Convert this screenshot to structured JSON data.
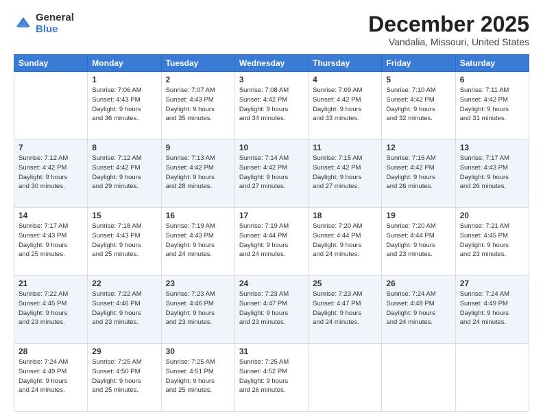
{
  "logo": {
    "general": "General",
    "blue": "Blue"
  },
  "header": {
    "month": "December 2025",
    "location": "Vandalia, Missouri, United States"
  },
  "weekdays": [
    "Sunday",
    "Monday",
    "Tuesday",
    "Wednesday",
    "Thursday",
    "Friday",
    "Saturday"
  ],
  "weeks": [
    [
      {
        "day": "",
        "info": ""
      },
      {
        "day": "1",
        "info": "Sunrise: 7:06 AM\nSunset: 4:43 PM\nDaylight: 9 hours\nand 36 minutes."
      },
      {
        "day": "2",
        "info": "Sunrise: 7:07 AM\nSunset: 4:43 PM\nDaylight: 9 hours\nand 35 minutes."
      },
      {
        "day": "3",
        "info": "Sunrise: 7:08 AM\nSunset: 4:42 PM\nDaylight: 9 hours\nand 34 minutes."
      },
      {
        "day": "4",
        "info": "Sunrise: 7:09 AM\nSunset: 4:42 PM\nDaylight: 9 hours\nand 33 minutes."
      },
      {
        "day": "5",
        "info": "Sunrise: 7:10 AM\nSunset: 4:42 PM\nDaylight: 9 hours\nand 32 minutes."
      },
      {
        "day": "6",
        "info": "Sunrise: 7:11 AM\nSunset: 4:42 PM\nDaylight: 9 hours\nand 31 minutes."
      }
    ],
    [
      {
        "day": "7",
        "info": "Sunrise: 7:12 AM\nSunset: 4:42 PM\nDaylight: 9 hours\nand 30 minutes."
      },
      {
        "day": "8",
        "info": "Sunrise: 7:12 AM\nSunset: 4:42 PM\nDaylight: 9 hours\nand 29 minutes."
      },
      {
        "day": "9",
        "info": "Sunrise: 7:13 AM\nSunset: 4:42 PM\nDaylight: 9 hours\nand 28 minutes."
      },
      {
        "day": "10",
        "info": "Sunrise: 7:14 AM\nSunset: 4:42 PM\nDaylight: 9 hours\nand 27 minutes."
      },
      {
        "day": "11",
        "info": "Sunrise: 7:15 AM\nSunset: 4:42 PM\nDaylight: 9 hours\nand 27 minutes."
      },
      {
        "day": "12",
        "info": "Sunrise: 7:16 AM\nSunset: 4:42 PM\nDaylight: 9 hours\nand 26 minutes."
      },
      {
        "day": "13",
        "info": "Sunrise: 7:17 AM\nSunset: 4:43 PM\nDaylight: 9 hours\nand 26 minutes."
      }
    ],
    [
      {
        "day": "14",
        "info": "Sunrise: 7:17 AM\nSunset: 4:43 PM\nDaylight: 9 hours\nand 25 minutes."
      },
      {
        "day": "15",
        "info": "Sunrise: 7:18 AM\nSunset: 4:43 PM\nDaylight: 9 hours\nand 25 minutes."
      },
      {
        "day": "16",
        "info": "Sunrise: 7:19 AM\nSunset: 4:43 PM\nDaylight: 9 hours\nand 24 minutes."
      },
      {
        "day": "17",
        "info": "Sunrise: 7:19 AM\nSunset: 4:44 PM\nDaylight: 9 hours\nand 24 minutes."
      },
      {
        "day": "18",
        "info": "Sunrise: 7:20 AM\nSunset: 4:44 PM\nDaylight: 9 hours\nand 24 minutes."
      },
      {
        "day": "19",
        "info": "Sunrise: 7:20 AM\nSunset: 4:44 PM\nDaylight: 9 hours\nand 23 minutes."
      },
      {
        "day": "20",
        "info": "Sunrise: 7:21 AM\nSunset: 4:45 PM\nDaylight: 9 hours\nand 23 minutes."
      }
    ],
    [
      {
        "day": "21",
        "info": "Sunrise: 7:22 AM\nSunset: 4:45 PM\nDaylight: 9 hours\nand 23 minutes."
      },
      {
        "day": "22",
        "info": "Sunrise: 7:22 AM\nSunset: 4:46 PM\nDaylight: 9 hours\nand 23 minutes."
      },
      {
        "day": "23",
        "info": "Sunrise: 7:23 AM\nSunset: 4:46 PM\nDaylight: 9 hours\nand 23 minutes."
      },
      {
        "day": "24",
        "info": "Sunrise: 7:23 AM\nSunset: 4:47 PM\nDaylight: 9 hours\nand 23 minutes."
      },
      {
        "day": "25",
        "info": "Sunrise: 7:23 AM\nSunset: 4:47 PM\nDaylight: 9 hours\nand 24 minutes."
      },
      {
        "day": "26",
        "info": "Sunrise: 7:24 AM\nSunset: 4:48 PM\nDaylight: 9 hours\nand 24 minutes."
      },
      {
        "day": "27",
        "info": "Sunrise: 7:24 AM\nSunset: 4:49 PM\nDaylight: 9 hours\nand 24 minutes."
      }
    ],
    [
      {
        "day": "28",
        "info": "Sunrise: 7:24 AM\nSunset: 4:49 PM\nDaylight: 9 hours\nand 24 minutes."
      },
      {
        "day": "29",
        "info": "Sunrise: 7:25 AM\nSunset: 4:50 PM\nDaylight: 9 hours\nand 25 minutes."
      },
      {
        "day": "30",
        "info": "Sunrise: 7:25 AM\nSunset: 4:51 PM\nDaylight: 9 hours\nand 25 minutes."
      },
      {
        "day": "31",
        "info": "Sunrise: 7:25 AM\nSunset: 4:52 PM\nDaylight: 9 hours\nand 26 minutes."
      },
      {
        "day": "",
        "info": ""
      },
      {
        "day": "",
        "info": ""
      },
      {
        "day": "",
        "info": ""
      }
    ]
  ]
}
